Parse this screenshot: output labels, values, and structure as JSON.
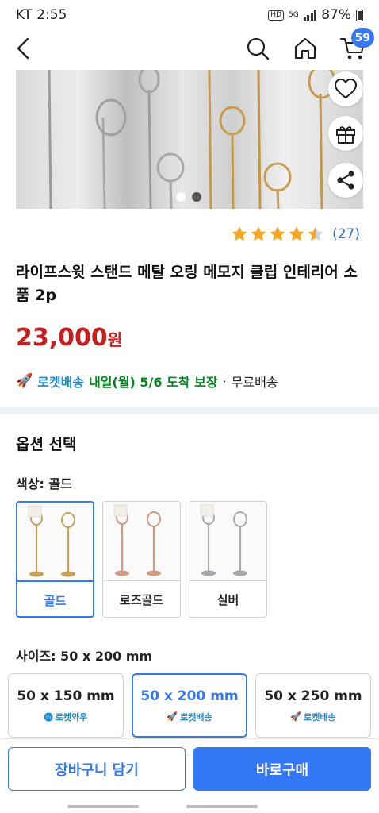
{
  "status_bar": {
    "carrier": "KT",
    "time": "2:55",
    "hd_label": "HD",
    "network_label": "5G",
    "battery": "87%"
  },
  "header": {
    "back_icon": "chevron-left-icon",
    "search_icon": "search-icon",
    "home_icon": "home-icon",
    "cart_icon": "cart-icon",
    "cart_count": "59"
  },
  "gallery": {
    "page_count": 2,
    "current_page": 2,
    "actions": [
      "heart-icon",
      "gift-icon",
      "share-icon"
    ]
  },
  "product": {
    "rating_value": 4.5,
    "review_count": "(27)",
    "title": "라이프스윗 스탠드 메탈 오링 메모지 클립 인테리어 소품 2p",
    "price": "23,000",
    "price_unit": "원"
  },
  "delivery": {
    "rocket_label": "로켓배송",
    "date_text": "내일(월) 5/6 도착 보장",
    "separator": "·",
    "free_text": "무료배송"
  },
  "options": {
    "section_title": "옵션 선택",
    "color_label": "색상: 골드",
    "colors": [
      {
        "name": "골드",
        "selected": true,
        "tint": "#c9a15a"
      },
      {
        "name": "로즈골드",
        "selected": false,
        "tint": "#d49a80"
      },
      {
        "name": "실버",
        "selected": false,
        "tint": "#a9a9ad"
      }
    ],
    "size_label": "사이즈: 50 x 200 mm",
    "sizes": [
      {
        "name": "50 x 150 mm",
        "badge": "로켓와우",
        "selected": false
      },
      {
        "name": "50 x 200 mm",
        "badge": "로켓배송",
        "selected": true
      },
      {
        "name": "50 x 250 mm",
        "badge": "로켓배송",
        "selected": false
      }
    ]
  },
  "bottom": {
    "cart_label": "장바구니 담기",
    "buy_label": "바로구매"
  },
  "colors": {
    "accent": "#3478f6",
    "price": "#c91d1d",
    "rocket": "#1a8bd6",
    "delivery_date": "#00891a",
    "star": "#f5a623"
  }
}
